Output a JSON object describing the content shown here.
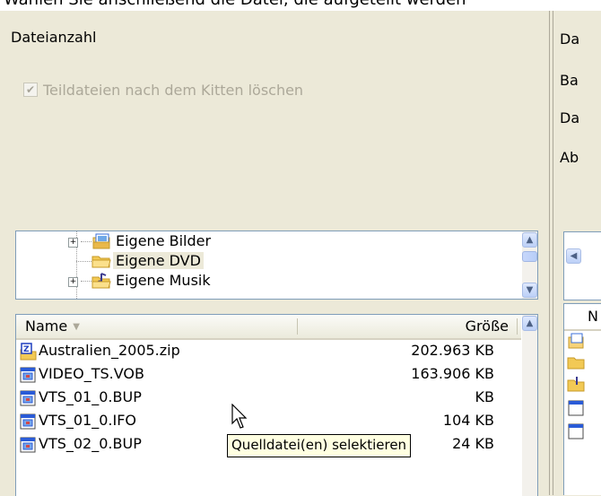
{
  "caption": "Wählen Sie anschließend die Datei, die aufgeteilt werden",
  "left": {
    "file_count_label": "Dateianzahl",
    "delete_checkbox": {
      "label": "Teildateien nach dem Kitten löschen",
      "checked": true,
      "disabled": true
    }
  },
  "tree": {
    "items": [
      {
        "label": "Eigene Bilder",
        "icon": "pictures-folder-icon",
        "expandable": true
      },
      {
        "label": "Eigene DVD",
        "icon": "folder-icon",
        "expandable": false,
        "selected": true
      },
      {
        "label": "Eigene Musik",
        "icon": "music-folder-icon",
        "expandable": true
      }
    ]
  },
  "file_list": {
    "columns": {
      "name": "Name",
      "size": "Größe"
    },
    "rows": [
      {
        "name": "Australien_2005.zip",
        "size": "202.963 KB",
        "icon": "zip-file-icon"
      },
      {
        "name": "VIDEO_TS.VOB",
        "size": "163.906 KB",
        "icon": "video-file-icon"
      },
      {
        "name": "VTS_01_0.BUP",
        "size": "KB",
        "icon": "video-file-icon"
      },
      {
        "name": "VTS_01_0.IFO",
        "size": "104 KB",
        "icon": "video-file-icon"
      },
      {
        "name": "VTS_02_0.BUP",
        "size": "24 KB",
        "icon": "video-file-icon"
      }
    ]
  },
  "tooltip": "Quelldatei(en) selektieren",
  "right": {
    "labels": [
      "Da",
      "Ba",
      "Da",
      "Ab"
    ],
    "list_header": "N"
  },
  "colors": {
    "window_bg": "#ece9d8",
    "border": "#7f9db9",
    "tooltip_bg": "#ffffe1"
  }
}
